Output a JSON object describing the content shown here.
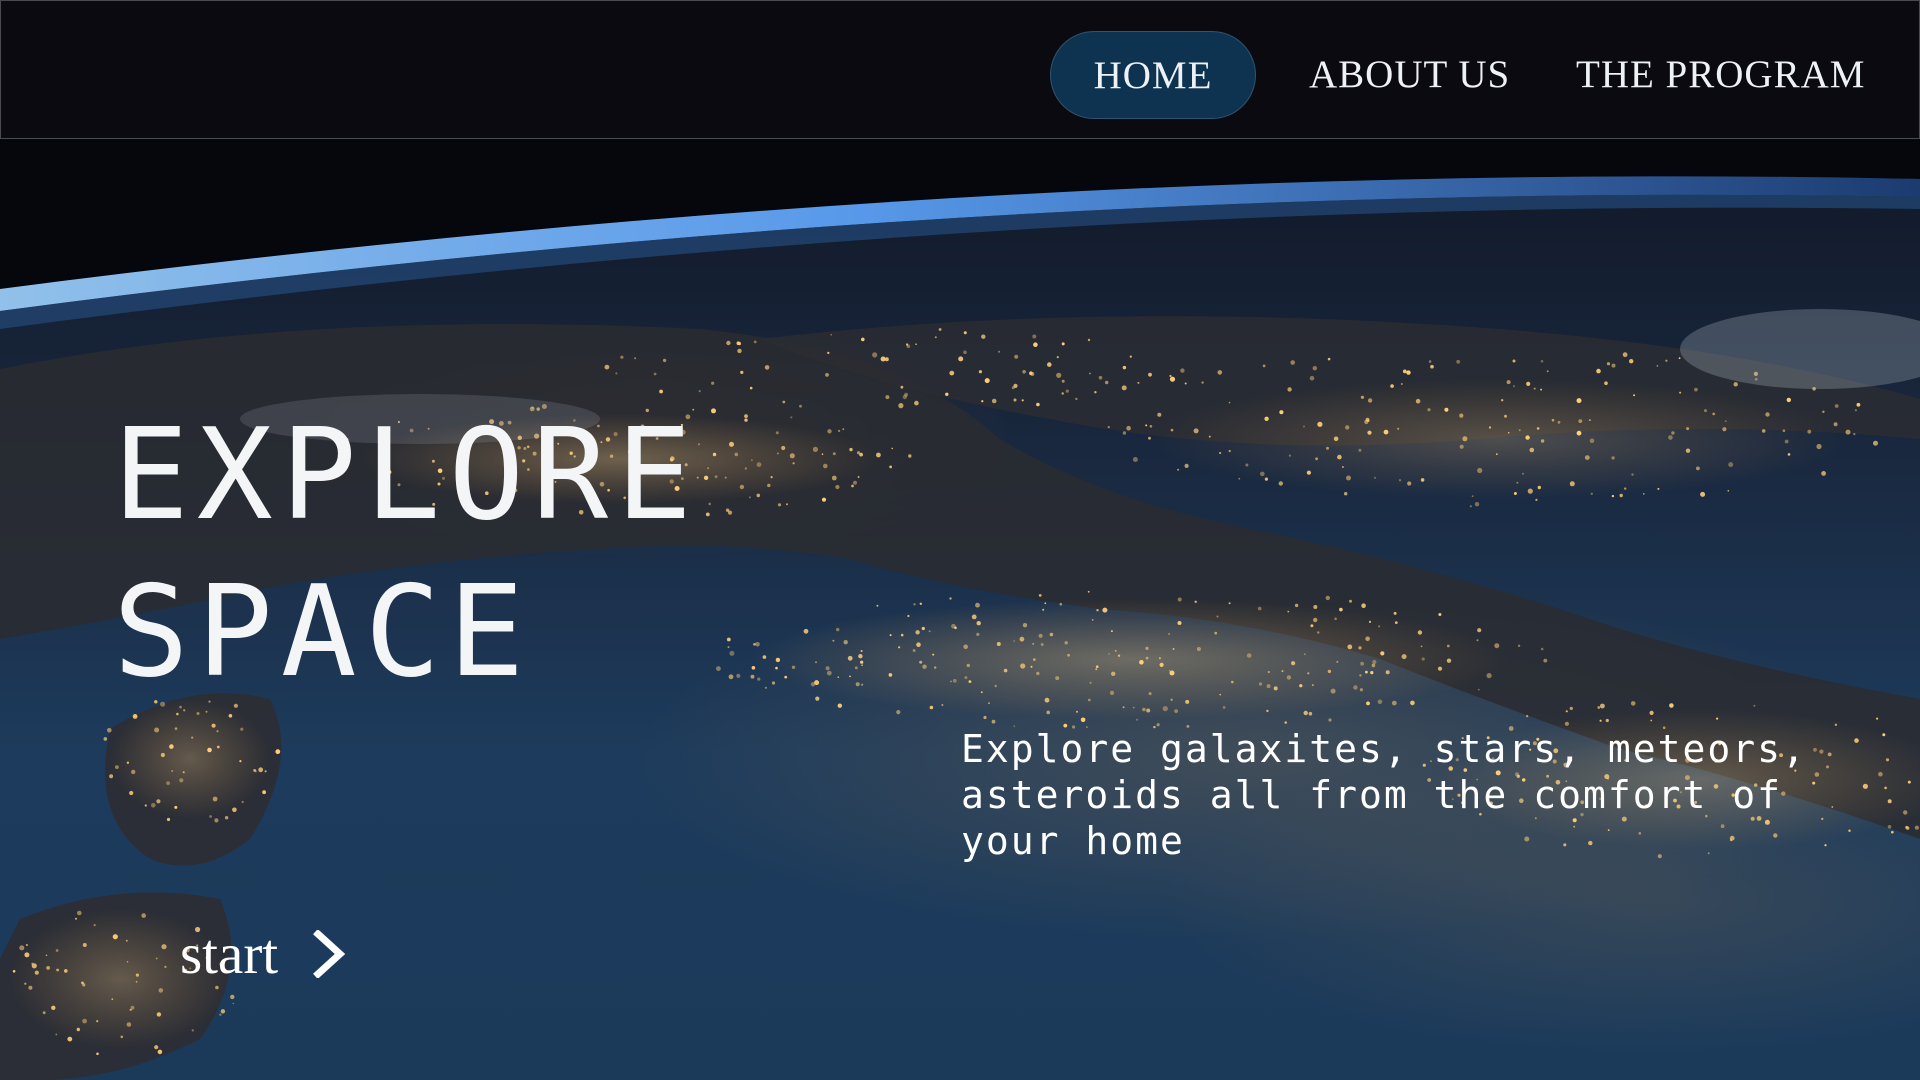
{
  "nav": {
    "items": [
      {
        "label": "HOME",
        "active": true
      },
      {
        "label": "ABOUT US",
        "active": false
      },
      {
        "label": "THE PROGRAM",
        "active": false
      }
    ],
    "active_color": "#0e3350"
  },
  "hero": {
    "title_line1": "EXPLORE",
    "title_line2": "SPACE",
    "description": "Explore galaxites, stars, meteors, asteroids all from the comfort of your home",
    "start_label": "start",
    "start_icon": "chevron-right-icon",
    "background": "earth-at-night-from-orbit-photo"
  }
}
